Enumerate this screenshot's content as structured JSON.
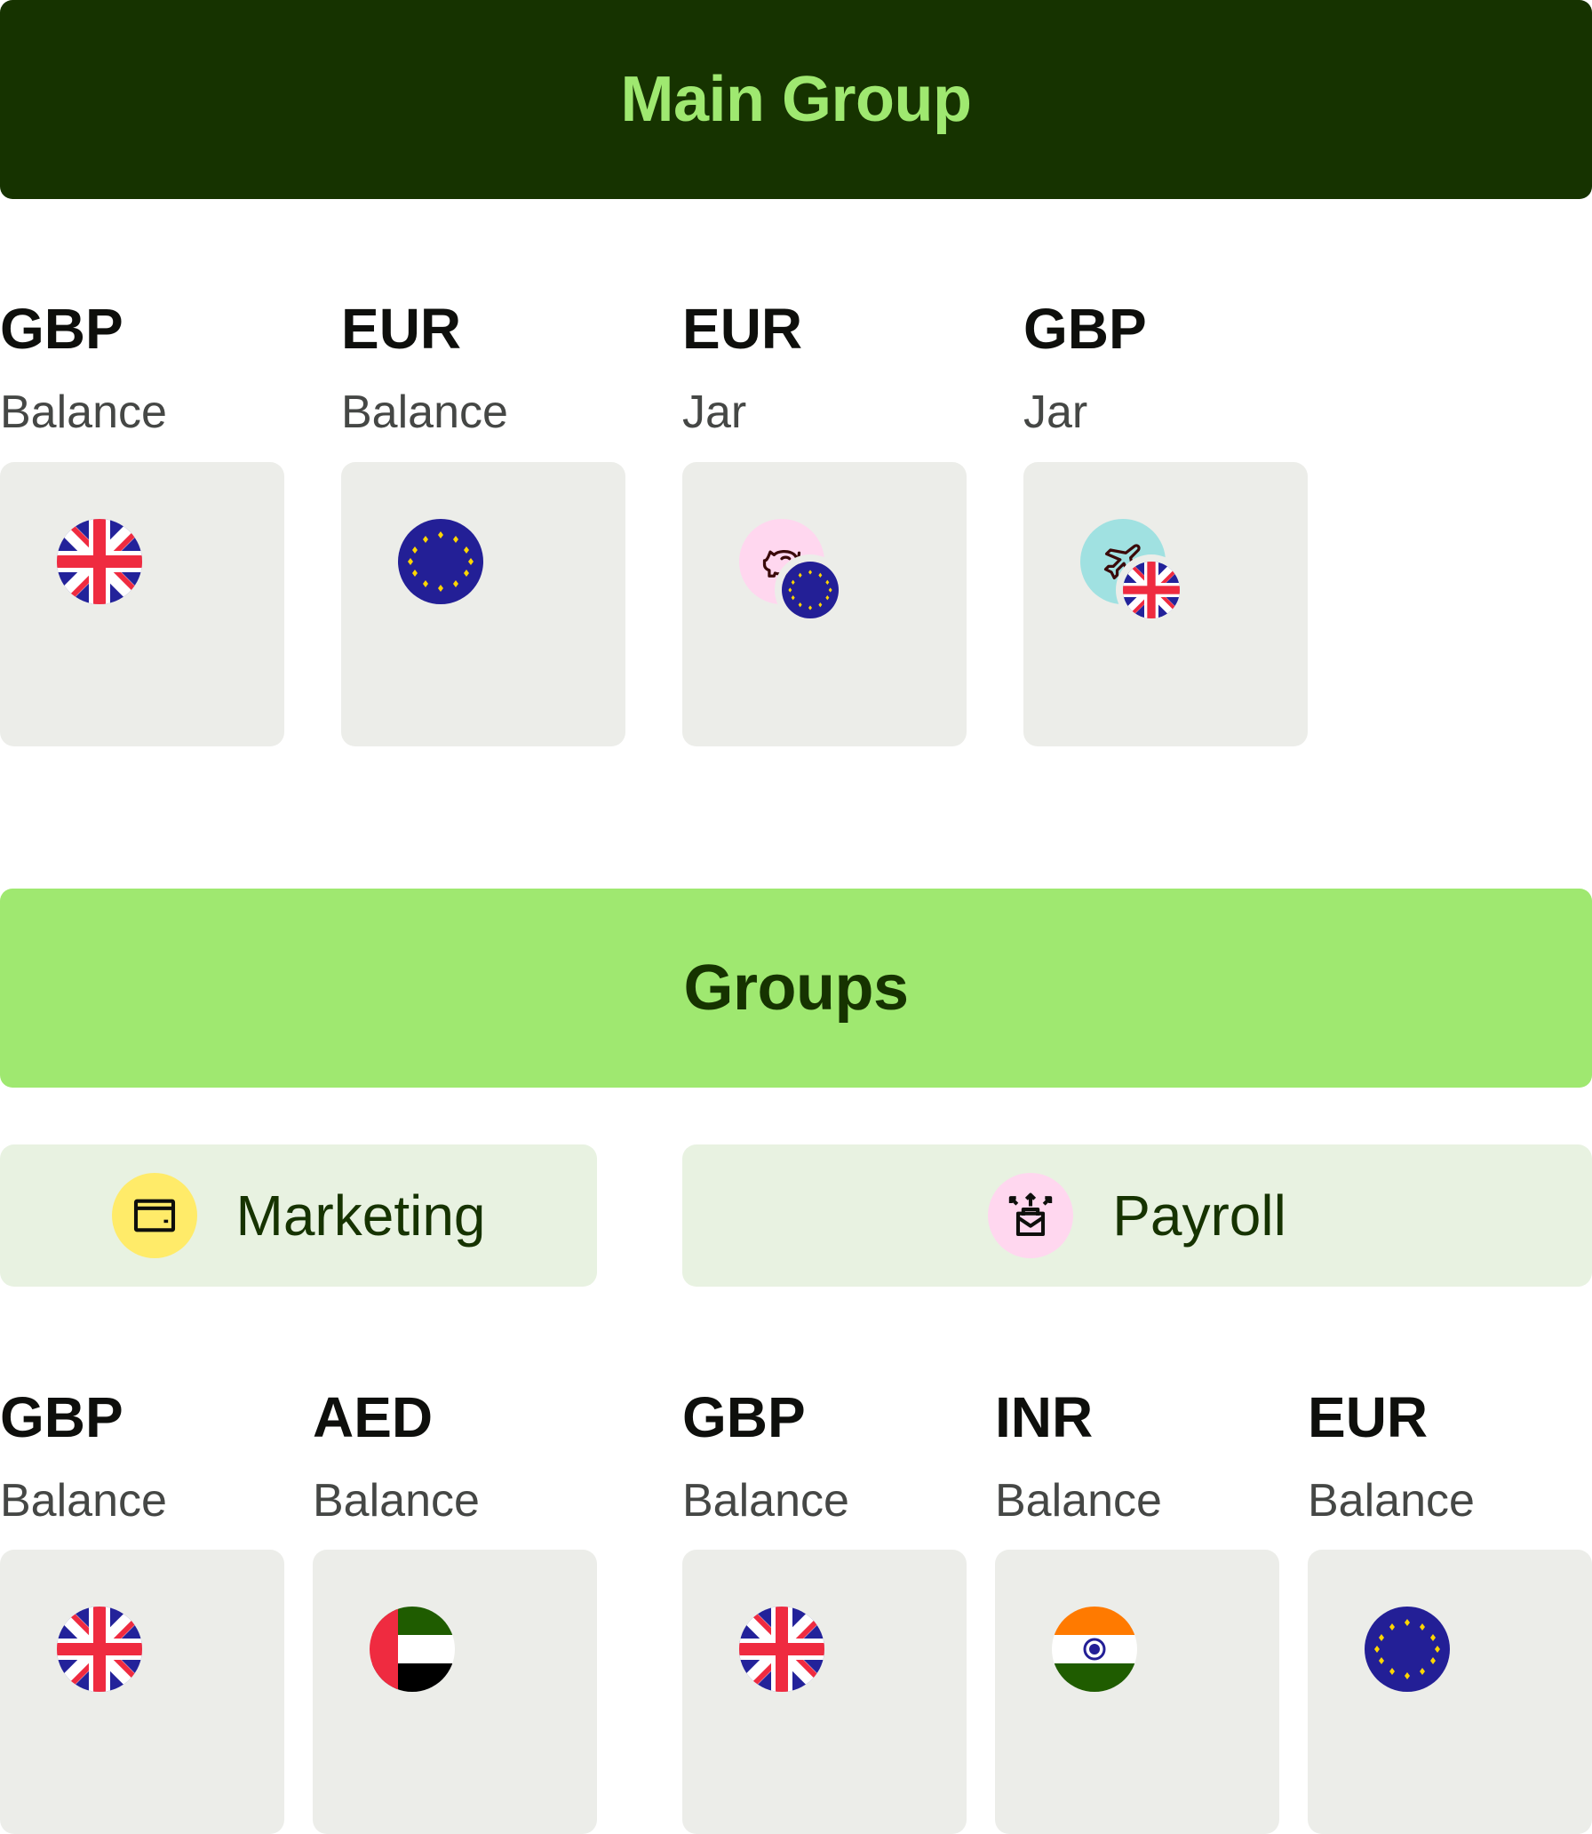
{
  "main_group": {
    "title": "Main Group",
    "accounts": [
      {
        "currency": "GBP",
        "type": "Balance",
        "icon": "uk-flag-icon"
      },
      {
        "currency": "EUR",
        "type": "Balance",
        "icon": "eu-flag-icon"
      },
      {
        "currency": "EUR",
        "type": "Jar",
        "icon": "piggy-bank-icon",
        "badge": "eu-flag-icon"
      },
      {
        "currency": "GBP",
        "type": "Jar",
        "icon": "airplane-icon",
        "badge": "uk-flag-icon"
      }
    ]
  },
  "groups": {
    "title": "Groups",
    "items": [
      {
        "name": "Marketing",
        "icon": "card-icon",
        "accounts": [
          {
            "currency": "GBP",
            "type": "Balance",
            "icon": "uk-flag-icon"
          },
          {
            "currency": "AED",
            "type": "Balance",
            "icon": "uae-flag-icon"
          }
        ]
      },
      {
        "name": "Payroll",
        "icon": "send-envelope-icon",
        "accounts": [
          {
            "currency": "GBP",
            "type": "Balance",
            "icon": "uk-flag-icon"
          },
          {
            "currency": "INR",
            "type": "Balance",
            "icon": "india-flag-icon"
          },
          {
            "currency": "EUR",
            "type": "Balance",
            "icon": "eu-flag-icon"
          }
        ]
      }
    ]
  },
  "colors": {
    "forest_green": "#163300",
    "bright_green": "#9fe870",
    "card_grey": "#ecede9",
    "pill_green": "#e8f2e1",
    "jar_pink": "#ffd7ef",
    "jar_teal": "#a0e1e1",
    "marketing_yellow": "#ffeb69",
    "payroll_pink": "#ffd7ef"
  }
}
